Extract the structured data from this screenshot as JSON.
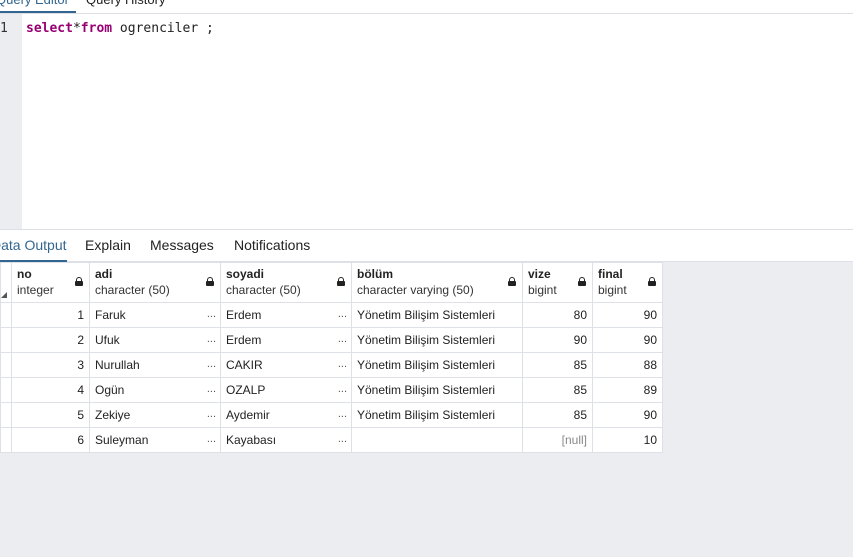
{
  "top_tabs": {
    "query_editor": "Query Editor",
    "query_history": "Query History"
  },
  "editor": {
    "line_number": "1",
    "kw_select": "select",
    "op_star": "*",
    "kw_from": "from",
    "rest": " ogrenciler ;"
  },
  "output_tabs": {
    "data_output": "Data Output",
    "explain": "Explain",
    "messages": "Messages",
    "notifications": "Notifications"
  },
  "columns": [
    {
      "name": "no",
      "type": "integer"
    },
    {
      "name": "adi",
      "type": "character (50)"
    },
    {
      "name": "soyadi",
      "type": "character (50)"
    },
    {
      "name": "bölüm",
      "type": "character varying (50)"
    },
    {
      "name": "vize",
      "type": "bigint"
    },
    {
      "name": "final",
      "type": "bigint"
    }
  ],
  "rows": [
    {
      "no": "1",
      "adi": "Faruk",
      "soyadi": "Erdem",
      "bolum": "Yönetim Bilişim Sistemleri",
      "vize": "80",
      "final": "90"
    },
    {
      "no": "2",
      "adi": "Ufuk",
      "soyadi": "Erdem",
      "bolum": "Yönetim Bilişim Sistemleri",
      "vize": "90",
      "final": "90"
    },
    {
      "no": "3",
      "adi": "Nurullah",
      "soyadi": "CAKIR",
      "bolum": "Yönetim Bilişim Sistemleri",
      "vize": "85",
      "final": "88"
    },
    {
      "no": "4",
      "adi": "Ogün",
      "soyadi": "OZALP",
      "bolum": "Yönetim Bilişim Sistemleri",
      "vize": "85",
      "final": "89"
    },
    {
      "no": "5",
      "adi": "Zekiye",
      "soyadi": "Aydemir",
      "bolum": "Yönetim Bilişim Sistemleri",
      "vize": "85",
      "final": "90"
    },
    {
      "no": "6",
      "adi": "Suleyman",
      "soyadi": "Kayabası",
      "bolum": "",
      "vize": "[null]",
      "final": "10"
    }
  ],
  "ellipsis": "..."
}
